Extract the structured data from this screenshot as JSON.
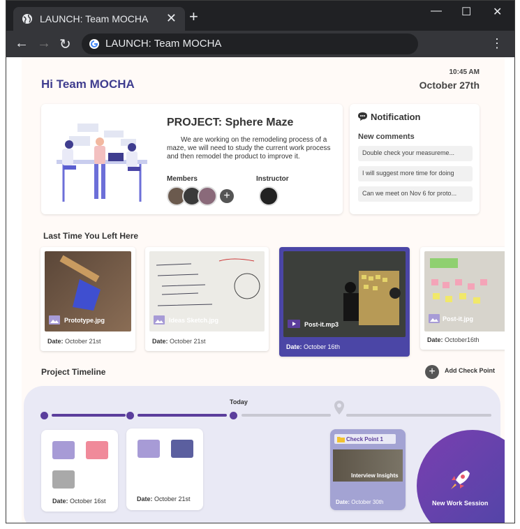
{
  "browser": {
    "tab_title": "LAUNCH: Team MOCHA",
    "tab_close": "✕",
    "new_tab": "+",
    "url": "LAUNCH: Team MOCHA",
    "minimize": "—",
    "maximize": "☐",
    "close": "✕",
    "menu": "⋮",
    "back": "←",
    "forward": "→",
    "reload": "↻"
  },
  "header": {
    "greeting": "Hi Team MOCHA",
    "time": "10:45 AM",
    "date": "October 27th"
  },
  "project": {
    "title": "PROJECT:  Sphere Maze",
    "description": "We are working on the remodeling process of a maze, we will need to study the current work process and then remodel the product to improve it.",
    "members_label": "Members",
    "instructor_label": "Instructor",
    "add_member": "+"
  },
  "notification": {
    "title": "Notification",
    "subtitle": "New comments",
    "comments": [
      "Double check your  measureme...",
      "I will suggest more time for doing",
      "Can we meet on Nov 6 for proto..."
    ]
  },
  "recent": {
    "title": "Last Time You Left Here",
    "date_label": "Date:",
    "items": [
      {
        "name": "Prototype.jpg",
        "date": "October 21st"
      },
      {
        "name": "Ideas Sketch.jpg",
        "date": "October 21st"
      },
      {
        "name": "Post-it.mp3",
        "date": "October 16th"
      },
      {
        "name": "Post-it.jpg",
        "date": "October16th"
      }
    ]
  },
  "timeline": {
    "title": "Project Timeline",
    "add_label": "Add Check Point",
    "add_icon": "+",
    "today_label": "Today",
    "date_label": "Date:",
    "cards": [
      {
        "date": "October 16st"
      },
      {
        "date": "October 21st"
      }
    ],
    "checkpoint": {
      "title": "Check Point 1",
      "caption": "Interview Insights",
      "date": "October 30th"
    },
    "new_session": "New Work Session"
  },
  "colors": {
    "brand": "#3f3d8f",
    "accent": "#5b3e9c",
    "selected_card": "#4b46a6"
  }
}
